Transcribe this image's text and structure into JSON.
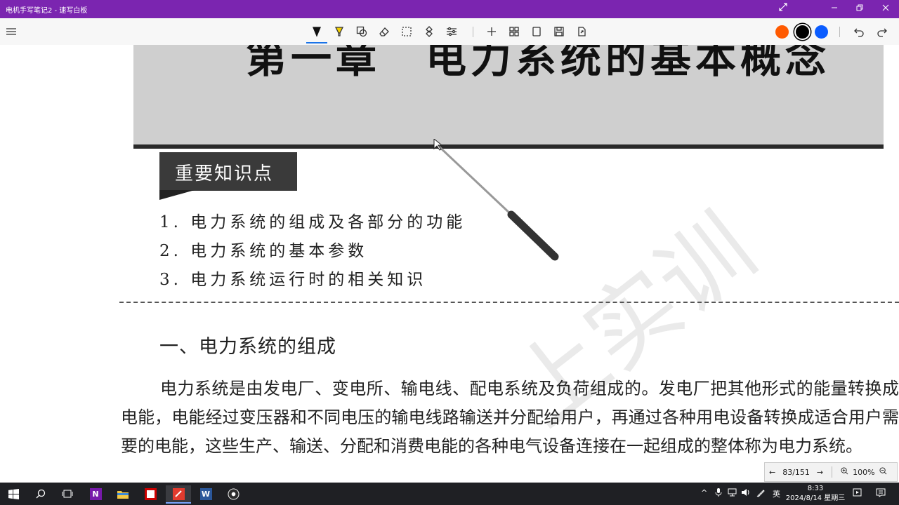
{
  "window": {
    "title": "电机手写笔记2 - 速写白板"
  },
  "toolbar": {
    "colors": [
      "#ff5a00",
      "#000000",
      "#0a5cff"
    ]
  },
  "document": {
    "key_points_title": "重要知识点",
    "key_points": [
      "1. 电力系统的组成及各部分的功能",
      "2. 电力系统的基本参数",
      "3. 电力系统运行时的相关知识"
    ],
    "section_heading": "一、电力系统的组成",
    "paragraph": "电力系统是由发电厂、变电所、输电线、配电系统及负荷组成的。发电厂把其他形式的能量转换成电能，电能经过变压器和不同电压的输电线路输送并分配给用户，再通过各种用电设备转换成适合用户需要的电能，这些生产、输送、分配和消费电能的各种电气设备连接在一起组成的整体称为电力系统。"
  },
  "pagebar": {
    "page": "83/151",
    "zoom": "100%"
  },
  "taskbar": {
    "ime": "英",
    "time": "8:33",
    "date": "2024/8/14 星期三"
  }
}
